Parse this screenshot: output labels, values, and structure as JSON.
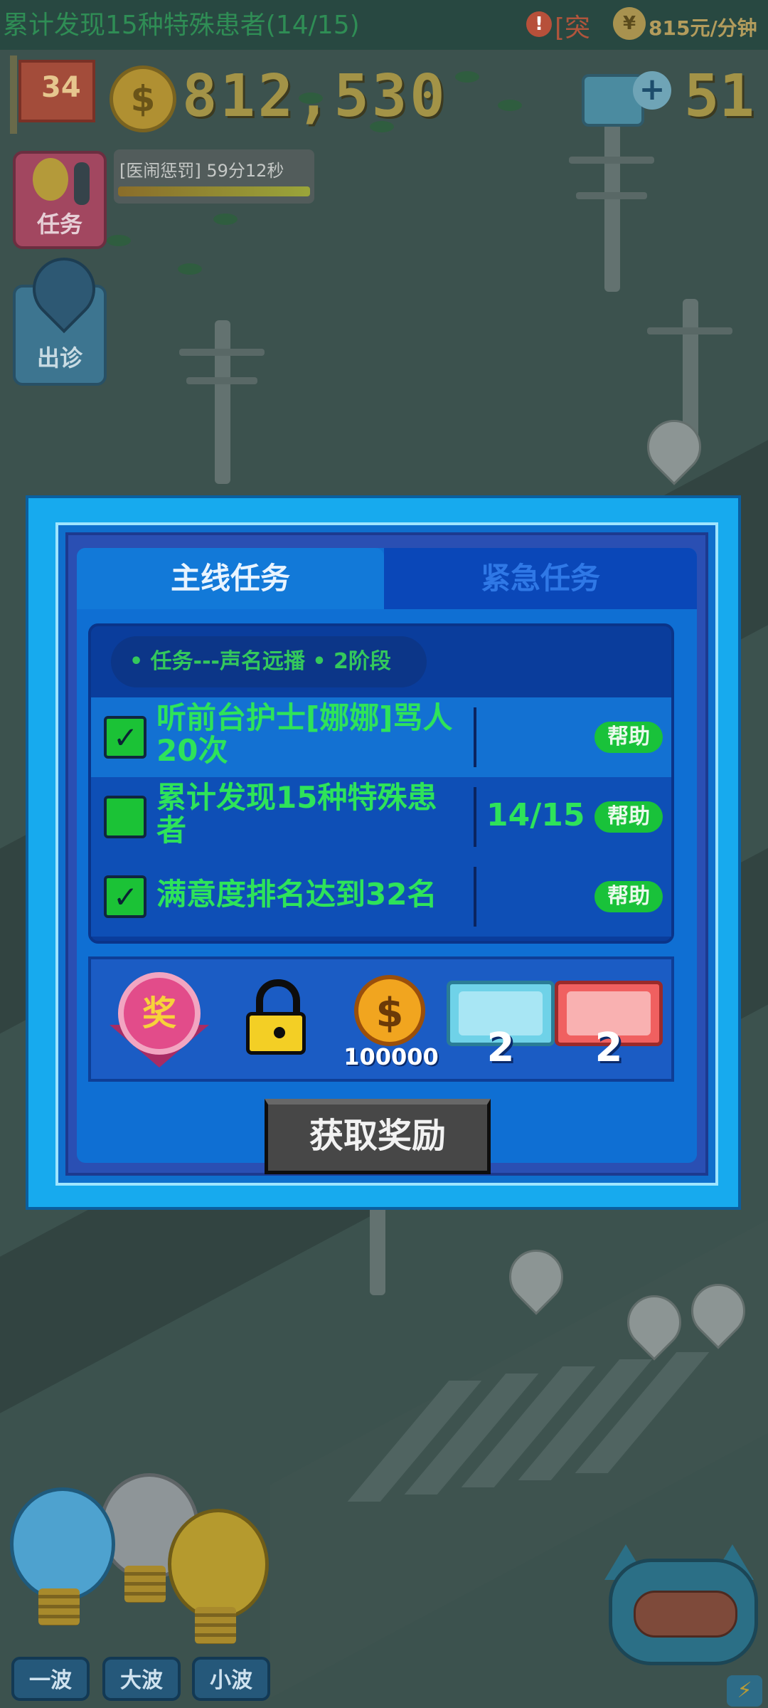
{
  "status_bar": {
    "current_task": "累计发现15种特殊患者(14/15)",
    "alert_icon": "!",
    "alert_text": "[突",
    "income_text": "815元/分钟",
    "colors": {
      "alert": "#b0553c",
      "income": "#b39c5c"
    }
  },
  "hud": {
    "level": "34",
    "coins": "812,530",
    "coin_icon": "$",
    "tickets": "51",
    "ticket_plus": "+"
  },
  "penalty": {
    "text": "[医闹惩罚] 59分12秒",
    "progress_fraction": 1.0
  },
  "side_buttons": {
    "task_label": "任务",
    "visit_label": "出诊"
  },
  "modal": {
    "tabs": [
      {
        "label": "主线任务",
        "active": true
      },
      {
        "label": "紧急任务",
        "active": false
      }
    ],
    "stage": "• 任务---声名远播 • 2阶段",
    "tasks": [
      {
        "label": "听前台护士[娜娜]骂人20次",
        "checked": true,
        "progress": "",
        "help": "帮助"
      },
      {
        "label": "累计发现15种特殊患者",
        "checked": false,
        "progress": "14/15",
        "help": "帮助"
      },
      {
        "label": "满意度排名达到32名",
        "checked": true,
        "progress": "",
        "help": "帮助"
      }
    ],
    "check_symbol": "✓",
    "rewards": {
      "medal_char": "奖",
      "coin_symbol": "$",
      "coin_amount": "100000",
      "ticket1_count": "2",
      "ticket2_count": "2"
    },
    "claim_button": "获取奖励"
  },
  "wave_buttons": [
    "一波",
    "大波",
    "小波"
  ],
  "bolt_icon": "⚡",
  "icons": [
    "alert-icon",
    "piggy-bank-icon",
    "level-flag-icon",
    "coin-icon",
    "ticket-icon",
    "task-bulb-icon",
    "ambulance-pin-icon",
    "medal-icon",
    "lock-icon",
    "cat-ticket-icon",
    "bolt-icon"
  ],
  "colors": {
    "modal_border": "#17aaee",
    "panel_bg": "#0f6fd3",
    "task_text": "#2ee35a",
    "help_button": "#19c23a",
    "claim_button": "#474747"
  }
}
